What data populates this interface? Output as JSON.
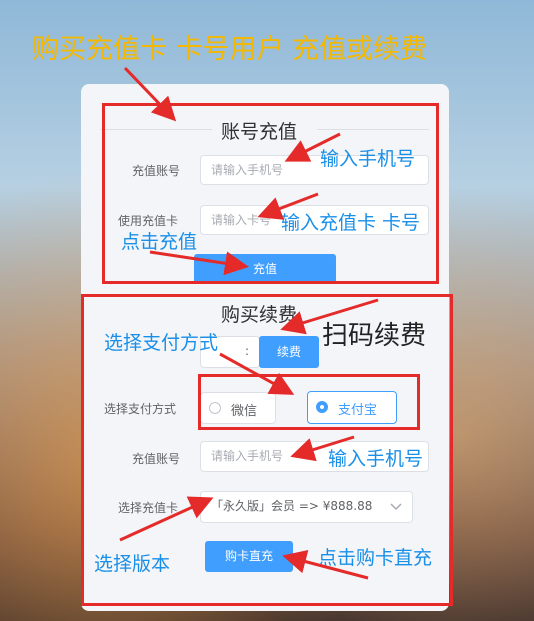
{
  "annotations": {
    "top": "购买充值卡 卡号用户 充值或续费",
    "enter_phone_1": "输入手机号",
    "enter_card": "输入充值卡 卡号",
    "click_recharge": "点击充值",
    "choose_payment": "选择支付方式",
    "scan_renew": "扫码续费",
    "enter_phone_2": "输入手机号",
    "choose_version": "选择版本",
    "click_buy": "点击购卡直充"
  },
  "recharge": {
    "title": "账号充值",
    "account_label": "充值账号",
    "account_placeholder": "请输入手机号",
    "card_label": "使用充值卡",
    "card_placeholder": "请输入卡号",
    "submit_label": "充值"
  },
  "renew": {
    "title": "购买续费",
    "tab_left": ":",
    "tab_right": "续费",
    "payment_label": "选择支付方式",
    "options": [
      "微信",
      "支付宝"
    ],
    "selected": "支付宝",
    "account_label": "充值账号",
    "account_placeholder": "请输入手机号",
    "card_label": "选择充值卡",
    "card_value": "「永久版」会员 => ¥888.88",
    "buy_label": "购卡直充"
  },
  "colors": {
    "accent": "#409eff",
    "annotation_red": "#e52a2a",
    "annotation_blue": "#1a8fe8",
    "annotation_gold": "#f5b800"
  }
}
